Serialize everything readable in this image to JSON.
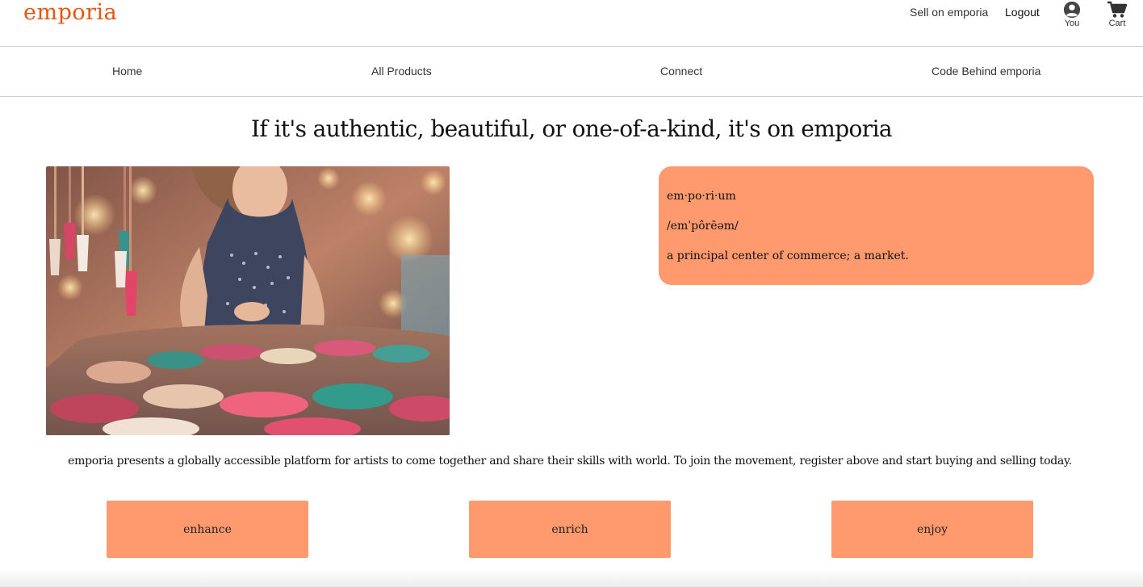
{
  "header": {
    "logo": "emporia",
    "sell_link": "Sell on emporia",
    "logout_link": "Logout",
    "profile": {
      "icon": "user-circle-icon",
      "label": "You"
    },
    "cart": {
      "icon": "shopping-cart-icon",
      "label": "Cart"
    },
    "brand_color": "#e8530f"
  },
  "nav": {
    "items": [
      {
        "label": "Home"
      },
      {
        "label": "All Products"
      },
      {
        "label": "Connect"
      },
      {
        "label": "Code Behind emporia"
      }
    ]
  },
  "main": {
    "headline": "If it's authentic, beautiful, or one-of-a-kind, it's on emporia",
    "hero_image": {
      "subject": "woman browsing jewelry at a market stall"
    },
    "definition": {
      "word": "em·po·ri·um",
      "pronunciation": "/emˈpôrēəm/",
      "meaning": "a principal center of commerce; a market."
    },
    "tagline": "emporia presents a globally accessible platform for artists to come together and share their skills with world. To join the movement, register above and start buying and selling today.",
    "buttons": [
      {
        "label": "enhance"
      },
      {
        "label": "enrich"
      },
      {
        "label": "enjoy"
      }
    ],
    "accent_color": "#fe9a6e"
  }
}
